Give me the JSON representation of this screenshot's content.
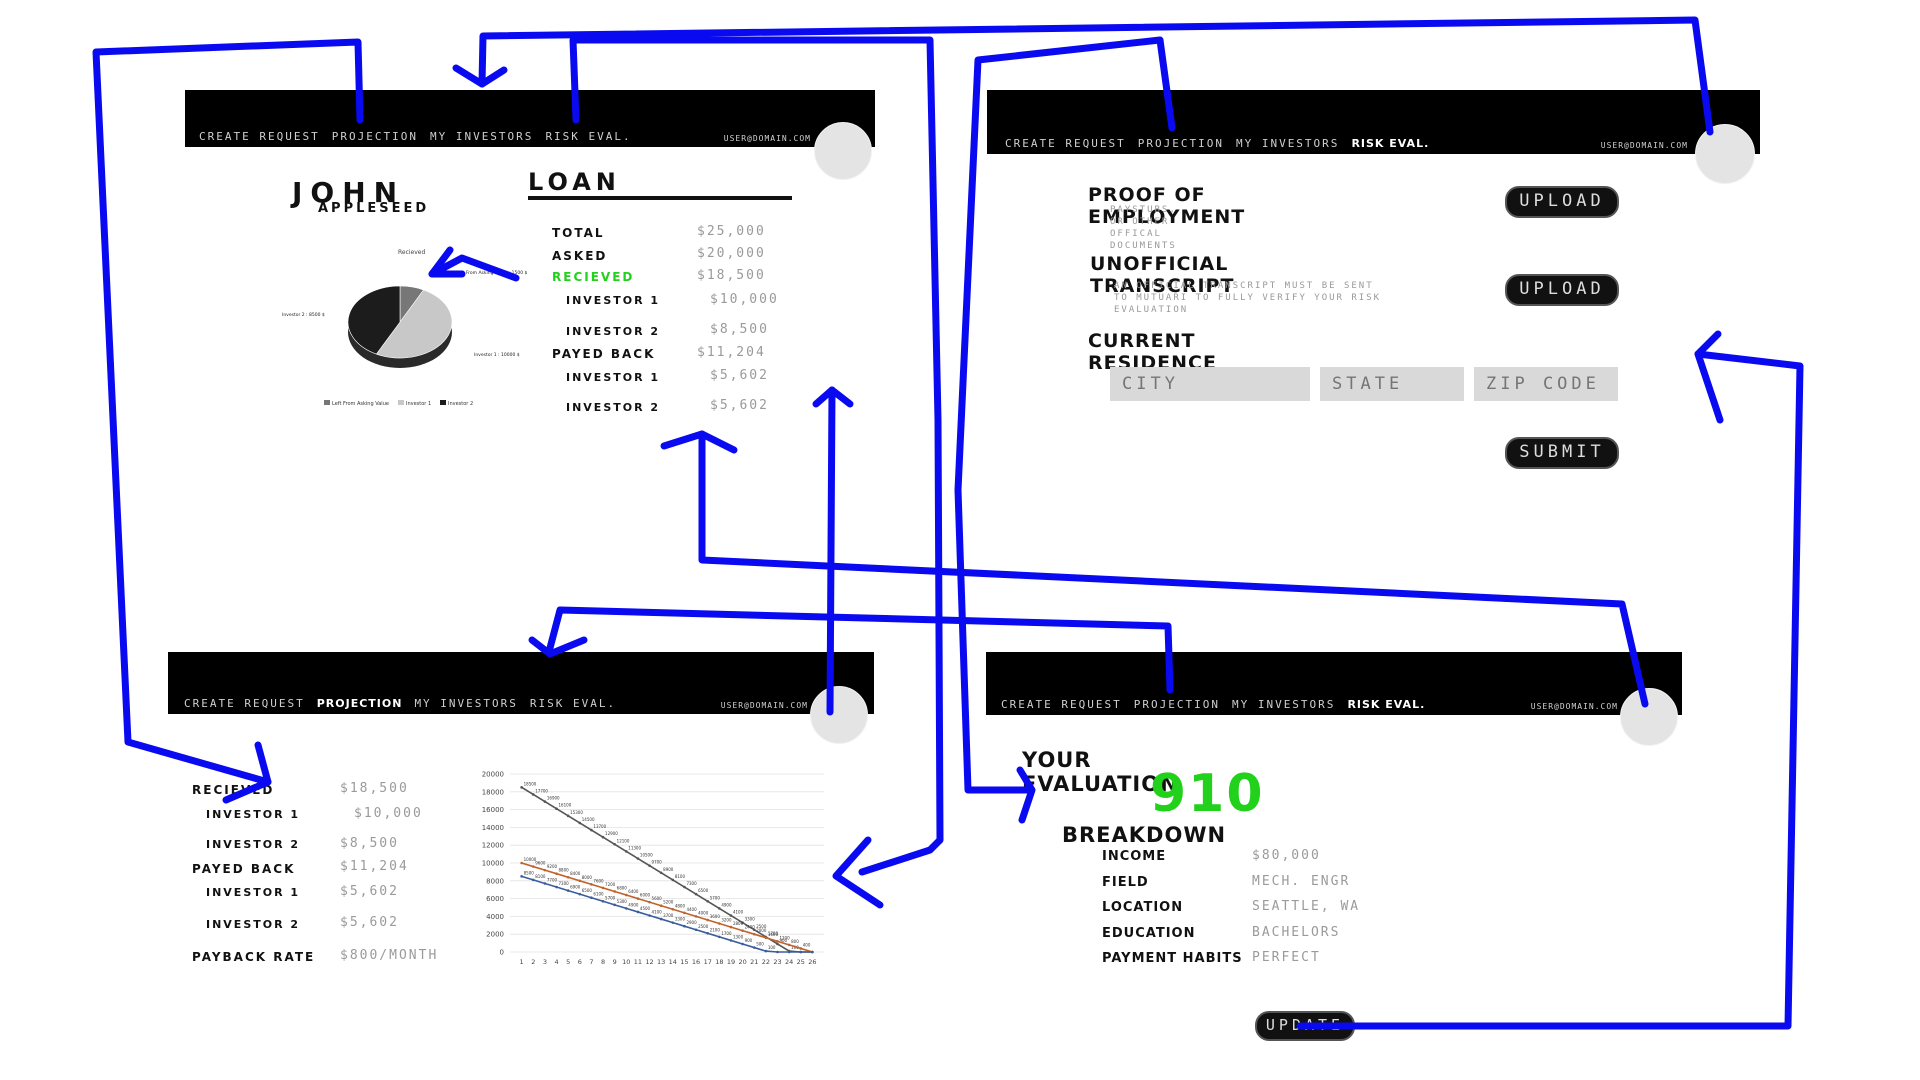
{
  "nav": {
    "create_request": "CREATE REQUEST",
    "projection": "PROJECTION",
    "my_investors": "MY INVESTORS",
    "risk_eval": "RISK EVAL.",
    "email": "USER@DOMAIN.COM"
  },
  "profile": {
    "first_name": "JOHN",
    "last_name": "APPLESEED",
    "loan_heading": "LOAN",
    "rows": [
      {
        "label": "TOTAL",
        "value": "$25,000"
      },
      {
        "label": "ASKED",
        "value": "$20,000"
      },
      {
        "label": "RECIEVED",
        "value": "$18,500"
      },
      {
        "label": "INVESTOR 1",
        "value": "$10,000"
      },
      {
        "label": "INVESTOR 2",
        "value": "$8,500"
      },
      {
        "label": "PAYED BACK",
        "value": "$11,204"
      },
      {
        "label": "INVESTOR 1",
        "value": "$5,602"
      },
      {
        "label": "INVESTOR 2",
        "value": "$5,602"
      }
    ],
    "pie": {
      "title": "Recieved",
      "labels": {
        "left": "Left From Asking Value : 1500 $",
        "inv1": "Investor 1 : 10000 $",
        "inv2": "Investor 2 : 8500 $"
      },
      "legend": [
        "Left From Asking Value",
        "Investor 1",
        "Investor 2"
      ],
      "values": [
        1500,
        10000,
        8500
      ],
      "colors": [
        "#777777",
        "#c8c8c8",
        "#1c1c1c"
      ]
    }
  },
  "risk_form": {
    "employment_title": "PROOF OF EMPLOYMENT",
    "employment_sub": "PAYSTUBS, OR OTHER OFFICAL DOCUMENTS",
    "transcript_title": "UNOFFICIAL TRANSCRIPT",
    "transcript_sub": "AN OFFICIAL TRANSCRIPT MUST BE SENT TO MUTUARI TO FULLY VERIFY YOUR RISK EVALUATION",
    "upload": "UPLOAD",
    "residence_title": "CURRENT RESIDENCE",
    "city_placeholder": "CITY",
    "state_placeholder": "STATE",
    "zip_placeholder": "ZIP CODE",
    "submit": "SUBMIT"
  },
  "projection": {
    "rows": [
      {
        "label": "RECIEVED",
        "value": "$18,500"
      },
      {
        "label": "INVESTOR 1",
        "value": "$10,000"
      },
      {
        "label": "INVESTOR 2",
        "value": "$8,500"
      },
      {
        "label": "PAYED BACK",
        "value": "$11,204"
      },
      {
        "label": "INVESTOR 1",
        "value": "$5,602"
      },
      {
        "label": "INVESTOR 2",
        "value": "$5,602"
      },
      {
        "label": "PAYBACK RATE",
        "value": "$800/MONTH"
      }
    ]
  },
  "evaluation": {
    "title": "YOUR EVALUATION",
    "score": "910",
    "breakdown_title": "BREAKDOWN",
    "rows": [
      {
        "label": "INCOME",
        "value": "$80,000"
      },
      {
        "label": "FIELD",
        "value": "MECH. ENGR"
      },
      {
        "label": "LOCATION",
        "value": "SEATTLE, WA"
      },
      {
        "label": "EDUCATION",
        "value": "BACHELORS"
      },
      {
        "label": "PAYMENT HABITS",
        "value": "PERFECT"
      }
    ],
    "update": "UPDATE"
  },
  "chart_data": {
    "type": "line",
    "x": [
      1,
      2,
      3,
      4,
      5,
      6,
      7,
      8,
      9,
      10,
      11,
      12,
      13,
      14,
      15,
      16,
      17,
      18,
      19,
      20,
      21,
      22,
      23,
      24,
      25,
      26
    ],
    "yticks": [
      0,
      2000,
      4000,
      6000,
      8000,
      10000,
      12000,
      14000,
      16000,
      18000,
      20000
    ],
    "ylim": [
      0,
      20000
    ],
    "series": [
      {
        "values": [
          18500,
          17700,
          16900,
          16100,
          15300,
          14500,
          13700,
          12900,
          12100,
          11300,
          10500,
          9700,
          8900,
          8100,
          7300,
          6500,
          5700,
          4900,
          4100,
          3300,
          2500,
          1700,
          900,
          100,
          0,
          0
        ],
        "color": "#555555"
      },
      {
        "values": [
          10000,
          9600,
          9200,
          8800,
          8400,
          8000,
          7600,
          7200,
          6800,
          6400,
          6000,
          5600,
          5200,
          4800,
          4400,
          4000,
          3600,
          3200,
          2800,
          2400,
          2000,
          1600,
          1200,
          800,
          400,
          0
        ],
        "color": "#c0622b"
      },
      {
        "values": [
          8500,
          8100,
          7700,
          7300,
          6900,
          6500,
          6100,
          5700,
          5300,
          4900,
          4500,
          4100,
          3700,
          3300,
          2900,
          2500,
          2100,
          1700,
          1300,
          900,
          500,
          100,
          0,
          0,
          0,
          0
        ],
        "color": "#3a5d9c"
      }
    ]
  },
  "colors": {
    "accent_green": "#22d11c",
    "arrow_blue": "#0a0af0",
    "navbar": "#000000"
  }
}
